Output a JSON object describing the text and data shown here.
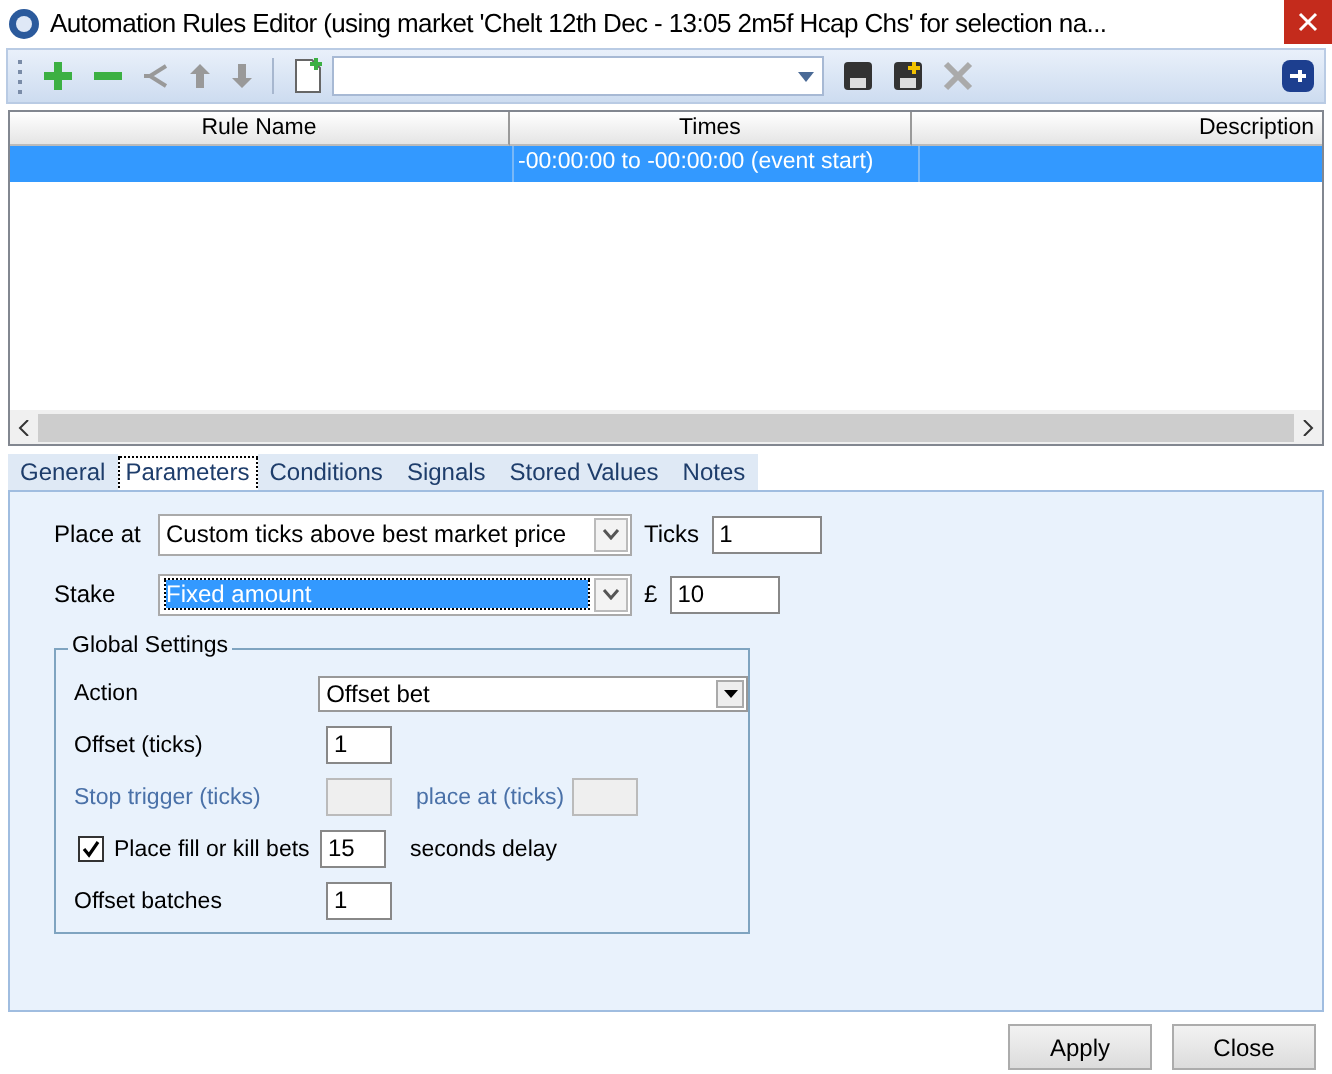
{
  "window": {
    "title": "Automation Rules Editor (using market 'Chelt 12th Dec - 13:05 2m5f Hcap Chs' for selection na..."
  },
  "table": {
    "columns": [
      "Rule Name",
      "Times",
      "Description"
    ],
    "rows": [
      {
        "times": "-00:00:00 to -00:00:00 (event start)",
        "selected": true
      }
    ]
  },
  "tabs": [
    {
      "label": "General",
      "selected": false
    },
    {
      "label": "Parameters",
      "selected": true
    },
    {
      "label": "Conditions",
      "selected": false
    },
    {
      "label": "Signals",
      "selected": false
    },
    {
      "label": "Stored Values",
      "selected": false
    },
    {
      "label": "Notes",
      "selected": false
    }
  ],
  "parameters": {
    "place_at": {
      "label": "Place at",
      "value": "Custom ticks above best market price",
      "focused": false
    },
    "ticks": {
      "label": "Ticks",
      "value": "1"
    },
    "stake": {
      "label": "Stake",
      "value": "Fixed amount",
      "focused": true
    },
    "amount": {
      "label": "£",
      "value": "10"
    }
  },
  "global_settings": {
    "title": "Global Settings",
    "action": {
      "label": "Action",
      "value": "Offset bet"
    },
    "offset": {
      "label": "Offset (ticks)",
      "value": "1"
    },
    "stop_trigger": {
      "label": "Stop trigger (ticks)",
      "disabled": true,
      "place_at_label": "place at (ticks)"
    },
    "fill_or_kill": {
      "label": "Place fill or kill bets",
      "checked": true,
      "value": "15",
      "suffix": "seconds delay"
    },
    "offset_batches": {
      "label": "Offset batches",
      "value": "1"
    }
  },
  "buttons": [
    "Apply",
    "Close"
  ]
}
